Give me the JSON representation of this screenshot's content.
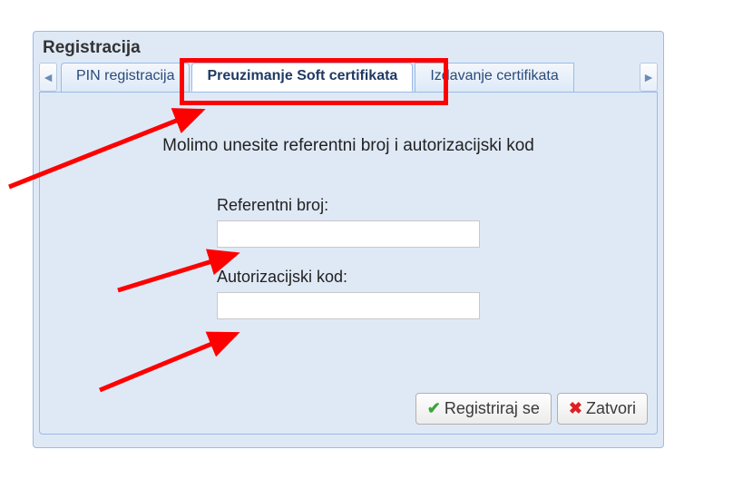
{
  "panel": {
    "title": "Registracija"
  },
  "tabs": {
    "prev_icon": "◄",
    "next_icon": "►",
    "items": [
      {
        "label": "PIN registracija",
        "active": false
      },
      {
        "label": "Preuzimanje Soft certifikata",
        "active": true
      },
      {
        "label": "Izdavanje certifikata",
        "active": false
      }
    ]
  },
  "content": {
    "instruction": "Molimo unesite referentni broj i autorizacijski kod",
    "fields": [
      {
        "label": "Referentni broj:",
        "value": ""
      },
      {
        "label": "Autorizacijski kod:",
        "value": ""
      }
    ]
  },
  "buttons": {
    "register": "Registriraj se",
    "close": "Zatvori"
  },
  "annotation_color": "#ff0000"
}
